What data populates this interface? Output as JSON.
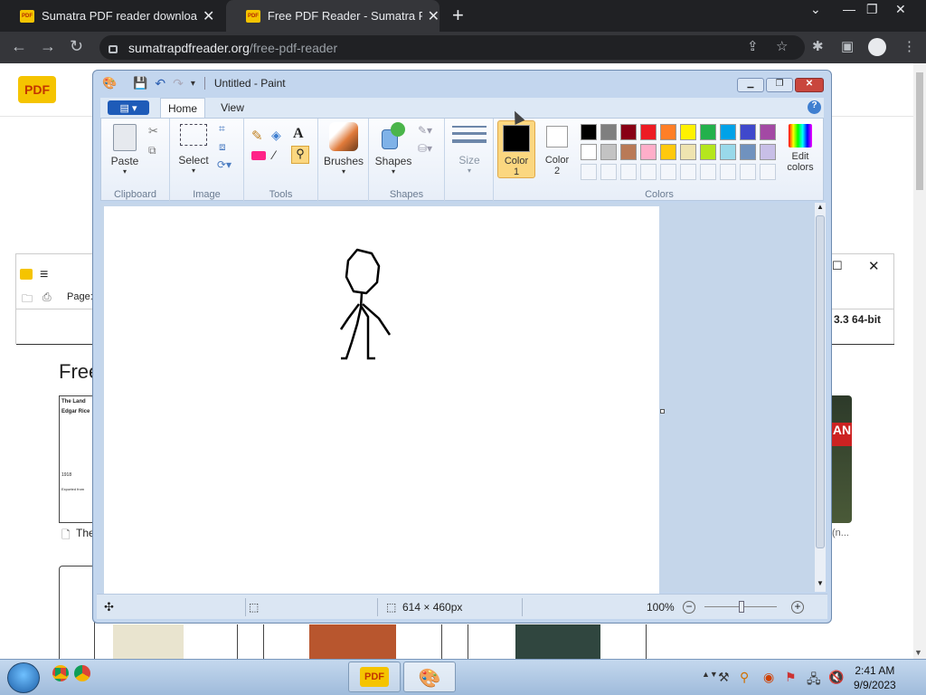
{
  "browser": {
    "tabs": [
      {
        "title": "Sumatra PDF reader download p",
        "active": false
      },
      {
        "title": "Free PDF Reader - Sumatra PDF",
        "active": true
      }
    ],
    "new_tab_icon": "+",
    "url": {
      "host": "sumatrapdfreader.org",
      "path": "/free-pdf-reader"
    }
  },
  "webpage": {
    "logo_text": "PDF",
    "toolbar_page_label": "Page:",
    "version_text": "3.3 64-bit",
    "section_title": "Free",
    "book1": {
      "line1": "The Land",
      "line2": "Edgar Rice",
      "year": "1918",
      "footer": "Exported from"
    },
    "book1_caption": "The",
    "book_right_caption": "(n..."
  },
  "paint": {
    "title": "Untitled - Paint",
    "tabs": [
      "Home",
      "View"
    ],
    "groups": {
      "clipboard": "Clipboard",
      "image": "Image",
      "tools": "Tools",
      "shapes": "Shapes",
      "colors": "Colors"
    },
    "buttons": {
      "paste": "Paste",
      "select": "Select",
      "brushes": "Brushes",
      "shapes": "Shapes",
      "size": "Size",
      "color1": "Color\n1",
      "color2": "Color\n2",
      "edit_colors": "Edit\ncolors"
    },
    "palette_row1": [
      "#000000",
      "#7f7f7f",
      "#880015",
      "#ed1c24",
      "#ff7f27",
      "#fff200",
      "#22b14c",
      "#00a2e8",
      "#3f48cc",
      "#a349a4"
    ],
    "palette_row2": [
      "#ffffff",
      "#c3c3c3",
      "#b97a57",
      "#ffaec9",
      "#ffc90e",
      "#efe4b0",
      "#b5e61d",
      "#99d9ea",
      "#7092be",
      "#c8bfe7"
    ],
    "color1": "#000000",
    "color2": "#ffffff",
    "status": {
      "image_size": "614 × 460px",
      "zoom": "100%"
    }
  },
  "taskbar": {
    "time": "2:41 AM",
    "date": "9/9/2023"
  }
}
